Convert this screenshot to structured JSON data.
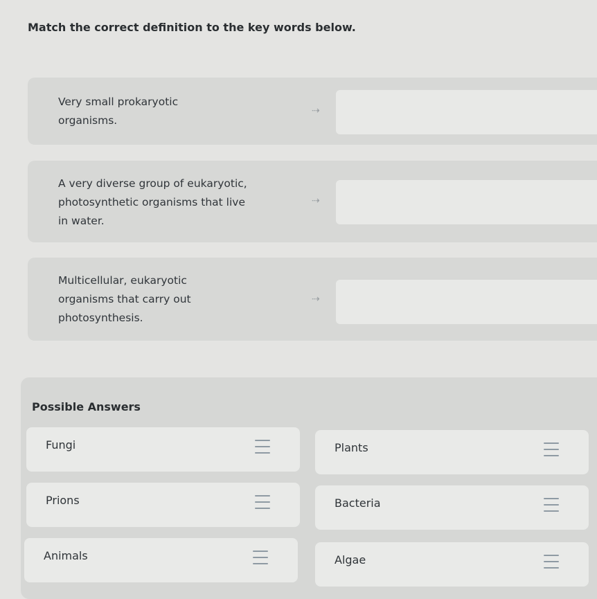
{
  "instruction": "Match the correct definition to the key words below.",
  "questions": [
    {
      "definition": [
        "Very small prokaryotic",
        "organisms."
      ],
      "arrow_icon": "arrow-right-icon",
      "answer": ""
    },
    {
      "definition": [
        "A very diverse group of eukaryotic,",
        "photosynthetic organisms that live",
        "in water."
      ],
      "arrow_icon": "arrow-right-icon",
      "answer": ""
    },
    {
      "definition": [
        "Multicellular, eukaryotic",
        "organisms that carry out",
        "photosynthesis."
      ],
      "arrow_icon": "arrow-right-icon",
      "answer": ""
    }
  ],
  "possible_answers": {
    "title": "Possible Answers",
    "items": [
      "Fungi",
      "Plants",
      "Prions",
      "Bacteria",
      "Animals",
      "Algae"
    ],
    "handle_icon": "drag-handle-icon"
  },
  "colors": {
    "background": "#e4e4e2",
    "card": "#d7d8d6",
    "dropzone": "#e8e9e7",
    "text": "#2b2f33",
    "handle": "#8e9aa3"
  }
}
